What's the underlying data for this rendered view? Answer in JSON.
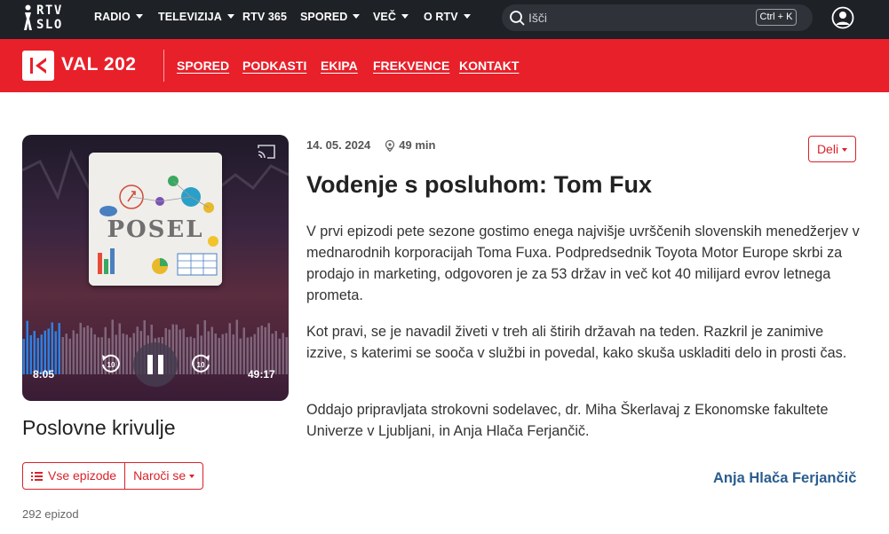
{
  "topnav": {
    "logo_line1": "RTV",
    "logo_line2": "SLO",
    "items": [
      {
        "label": "RADIO",
        "dropdown": true
      },
      {
        "label": "TELEVIZIJA",
        "dropdown": true
      },
      {
        "label": "RTV 365",
        "dropdown": false
      },
      {
        "label": "SPORED",
        "dropdown": true
      },
      {
        "label": "VEČ",
        "dropdown": true
      },
      {
        "label": "O RTV",
        "dropdown": true
      }
    ],
    "search_placeholder": "Išči",
    "search_shortcut": "Ctrl + K",
    "user_icon": "user-circle-icon"
  },
  "station": {
    "name": "VAL 202",
    "links": [
      "SPORED",
      "PODKASTI",
      "EKIPA",
      "FREKVENCE",
      "KONTAKT"
    ],
    "color": "#e8202a"
  },
  "player": {
    "cover_text": "POSEL",
    "elapsed": "8:05",
    "remaining": "49:17",
    "state": "playing",
    "progress": 0.14
  },
  "show": {
    "title": "Poslovne krivulje",
    "all_episodes_label": "Vse epizode",
    "subscribe_label": "Naroči se",
    "episode_count": "292 epizod"
  },
  "episode": {
    "date": "14. 05. 2024",
    "duration": "49 min",
    "share_label": "Deli",
    "title": "Vodenje s posluhom: Tom Fux",
    "paragraphs": [
      "V prvi epizodi pete sezone gostimo enega najvišje uvrščenih slovenskih menedžerjev v mednarodnih korporacijah Toma Fuxa. Podpredsednik Toyota Motor Europe skrbi za prodajo in marketing, odgovoren je za 53 držav in več kot 40 milijard evrov letnega prometa.",
      "Kot pravi, se je navadil živeti v treh ali štirih državah na teden. Razkril je zanimive izzive, s katerimi se sooča v službi in povedal, kako skuša uskladiti delo in prosti čas.",
      "Oddajo pripravljata strokovni sodelavec, dr. Miha Škerlavaj z Ekonomske fakultete Univerze v Ljubljani, in Anja Hlača Ferjančič."
    ],
    "author": "Anja Hlača Ferjančič"
  }
}
